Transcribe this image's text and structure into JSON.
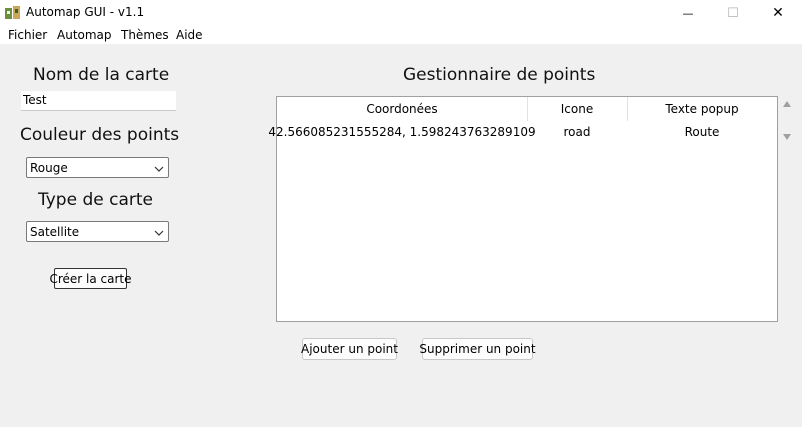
{
  "window": {
    "title": "Automap GUI - v1.1",
    "minimize_glyph": "—",
    "maximize_glyph": "☐",
    "close_glyph": "✕"
  },
  "menu": [
    "Fichier",
    "Automap",
    "Thèmes",
    "Aide"
  ],
  "left_panel": {
    "map_name_heading": "Nom de la carte",
    "map_name_value": "Test",
    "point_color_heading": "Couleur des points",
    "point_color_value": "Rouge",
    "map_type_heading": "Type de carte",
    "map_type_value": "Satellite",
    "create_button": "Créer la carte"
  },
  "points_manager": {
    "heading": "Gestionnaire de points",
    "columns": [
      "Coordonées",
      "Icone",
      "Texte popup"
    ],
    "rows": [
      [
        "42.566085231555284, 1.598243763289109",
        "road",
        "Route"
      ]
    ],
    "add_button": "Ajouter un point",
    "delete_button": "Supprimer un point"
  },
  "icons": {
    "app": "map-app-icon",
    "dropdown": "chevron-down-icon",
    "scroll_up": "triangle-up-icon",
    "scroll_down": "triangle-down-icon"
  },
  "colors": {
    "window_bg": "#f0f0f0",
    "titlebar_bg": "#ffffff",
    "accent_scroll": "#a0a0a0"
  }
}
